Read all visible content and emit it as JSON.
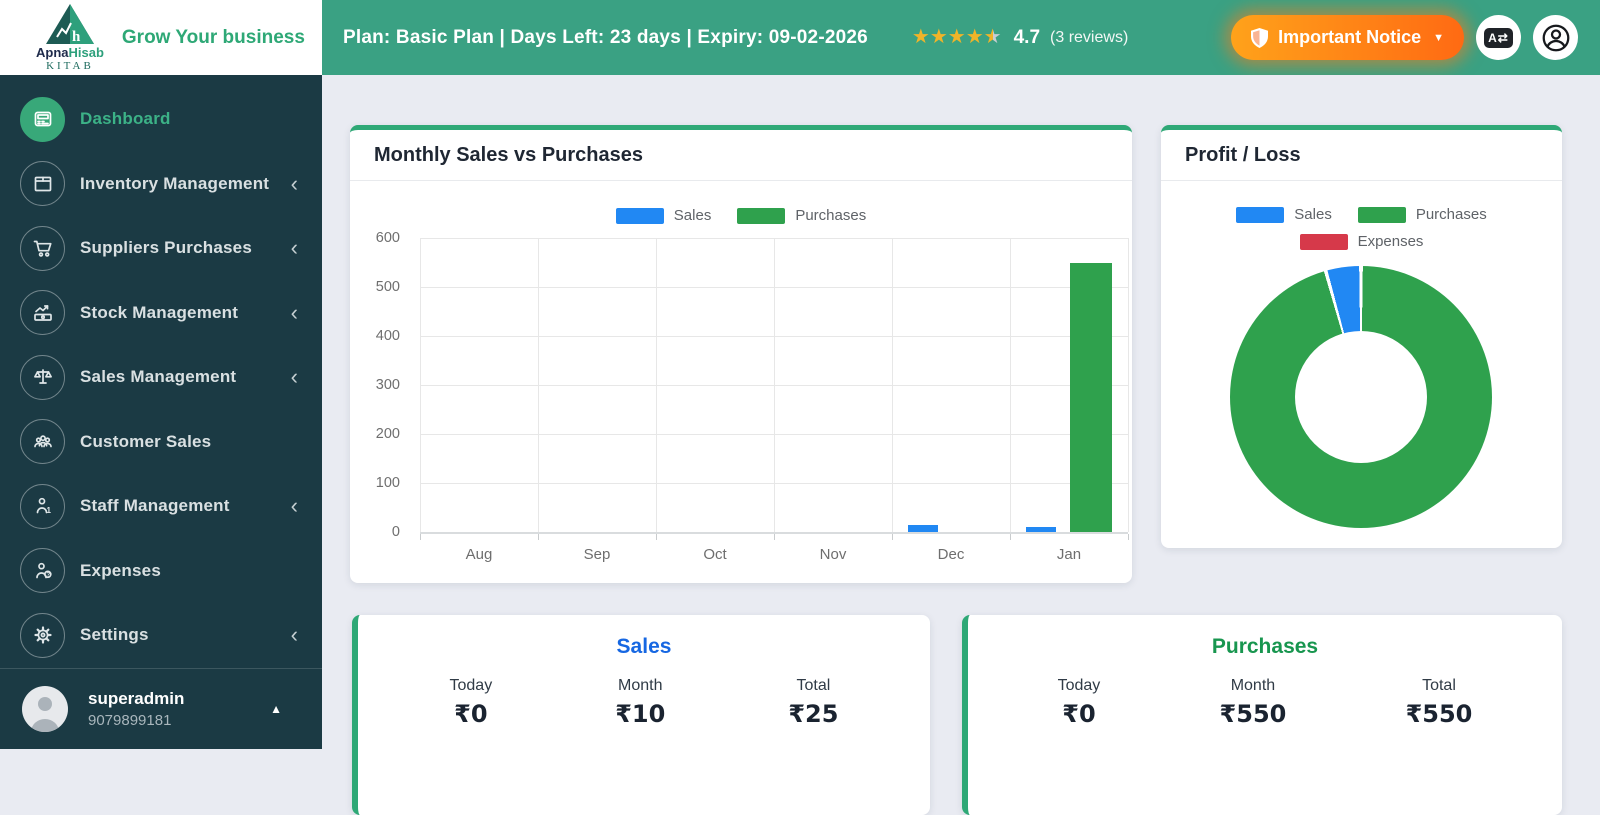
{
  "brand": {
    "name_part1": "Apna",
    "name_part2": "Hisab",
    "name_sub": "KITAB",
    "tagline": "Grow Your business"
  },
  "header": {
    "plan_text": "Plan: Basic Plan | Days Left: 23 days | Expiry: 09-02-2026",
    "rating": {
      "stars": 4.5,
      "value": "4.7",
      "reviews": "(3 reviews)"
    },
    "notice_label": "Important Notice"
  },
  "sidebar": {
    "items": [
      {
        "label": "Dashboard",
        "icon": "dashboard-icon",
        "active": true,
        "has_submenu": false
      },
      {
        "label": "Inventory Management",
        "icon": "inventory-icon",
        "active": false,
        "has_submenu": true
      },
      {
        "label": "Suppliers Purchases",
        "icon": "cart-icon",
        "active": false,
        "has_submenu": true
      },
      {
        "label": "Stock Management",
        "icon": "stock-icon",
        "active": false,
        "has_submenu": true
      },
      {
        "label": "Sales Management",
        "icon": "scale-icon",
        "active": false,
        "has_submenu": true
      },
      {
        "label": "Customer Sales",
        "icon": "customers-icon",
        "active": false,
        "has_submenu": false
      },
      {
        "label": "Staff Management",
        "icon": "staff-icon",
        "active": false,
        "has_submenu": true
      },
      {
        "label": "Expenses",
        "icon": "expenses-icon",
        "active": false,
        "has_submenu": false
      },
      {
        "label": "Settings",
        "icon": "settings-icon",
        "active": false,
        "has_submenu": true
      }
    ],
    "user": {
      "name": "superadmin",
      "phone": "9079899181"
    }
  },
  "chart_data": [
    {
      "type": "bar",
      "title": "Monthly Sales vs Purchases",
      "categories": [
        "Aug",
        "Sep",
        "Oct",
        "Nov",
        "Dec",
        "Jan"
      ],
      "series": [
        {
          "name": "Sales",
          "color": "#2188F3",
          "values": [
            0,
            0,
            0,
            0,
            15,
            10
          ]
        },
        {
          "name": "Purchases",
          "color": "#2FA14D",
          "values": [
            0,
            0,
            0,
            0,
            0,
            550
          ]
        }
      ],
      "ylim": [
        0,
        600
      ],
      "ytick_step": 100,
      "grid": true,
      "legend_position": "top"
    },
    {
      "type": "pie",
      "title": "Profit / Loss",
      "donut": true,
      "labels": [
        "Sales",
        "Purchases",
        "Expenses"
      ],
      "values": [
        25,
        550,
        0
      ],
      "colors": [
        "#2188F3",
        "#2FA14D",
        "#D6394A"
      ],
      "legend_position": "top"
    }
  ],
  "summary_cards": [
    {
      "title": "Sales",
      "title_color": "#1667E2",
      "stats": [
        {
          "label": "Today",
          "value": "₹0"
        },
        {
          "label": "Month",
          "value": "₹10"
        },
        {
          "label": "Total",
          "value": "₹25"
        }
      ]
    },
    {
      "title": "Purchases",
      "title_color": "#18964F",
      "stats": [
        {
          "label": "Today",
          "value": "₹0"
        },
        {
          "label": "Month",
          "value": "₹550"
        },
        {
          "label": "Total",
          "value": "₹550"
        }
      ]
    }
  ],
  "colors": {
    "header_bg": "#3AA183",
    "sidebar_bg": "#1B3A44",
    "accent_green": "#2EA876",
    "sales_blue": "#2188F3",
    "purchases_green": "#2FA14D",
    "expenses_red": "#D6394A",
    "star_gold": "#F0B429"
  }
}
